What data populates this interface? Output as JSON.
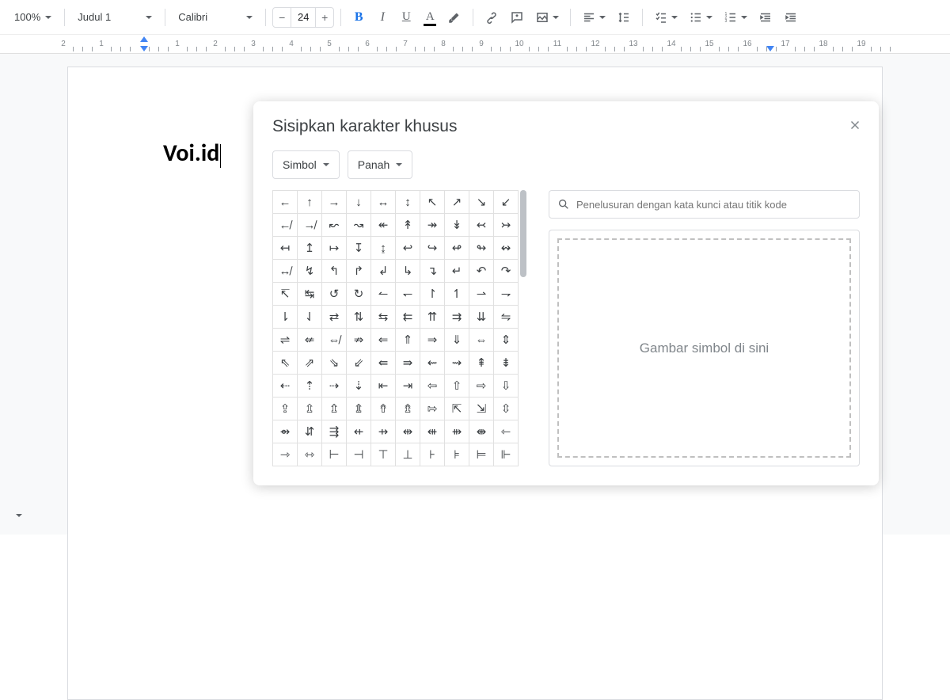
{
  "toolbar": {
    "zoom": "100%",
    "style": "Judul 1",
    "font": "Calibri",
    "fontSize": "24",
    "minusLabel": "−",
    "plusLabel": "+",
    "boldLabel": "B",
    "italicLabel": "I",
    "underlineLabel": "U"
  },
  "ruler": {
    "marks": [
      "2",
      "1",
      "",
      "1",
      "2",
      "3",
      "4",
      "5",
      "6",
      "7",
      "8",
      "9",
      "10",
      "11",
      "12",
      "13",
      "14",
      "15",
      "16",
      "17",
      "18",
      "19"
    ]
  },
  "document": {
    "text": "Voi.id"
  },
  "dialog": {
    "title": "Sisipkan karakter khusus",
    "filter1": "Simbol",
    "filter2": "Panah",
    "searchPlaceholder": "Penelusuran dengan kata kunci atau titik kode",
    "drawPlaceholder": "Gambar simbol di sini",
    "chars": [
      [
        "←",
        "↑",
        "→",
        "↓",
        "↔",
        "↕",
        "↖",
        "↗",
        "↘",
        "↙"
      ],
      [
        "↚",
        "↛",
        "↜",
        "↝",
        "↞",
        "↟",
        "↠",
        "↡",
        "↢",
        "↣"
      ],
      [
        "↤",
        "↥",
        "↦",
        "↧",
        "↨",
        "↩",
        "↪",
        "↫",
        "↬",
        "↭"
      ],
      [
        "↮",
        "↯",
        "↰",
        "↱",
        "↲",
        "↳",
        "↴",
        "↵",
        "↶",
        "↷"
      ],
      [
        "↸",
        "↹",
        "↺",
        "↻",
        "↼",
        "↽",
        "↾",
        "↿",
        "⇀",
        "⇁"
      ],
      [
        "⇂",
        "⇃",
        "⇄",
        "⇅",
        "⇆",
        "⇇",
        "⇈",
        "⇉",
        "⇊",
        "⇋"
      ],
      [
        "⇌",
        "⇍",
        "⇎",
        "⇏",
        "⇐",
        "⇑",
        "⇒",
        "⇓",
        "⇔",
        "⇕"
      ],
      [
        "⇖",
        "⇗",
        "⇘",
        "⇙",
        "⇚",
        "⇛",
        "⇜",
        "⇝",
        "⇞",
        "⇟"
      ],
      [
        "⇠",
        "⇡",
        "⇢",
        "⇣",
        "⇤",
        "⇥",
        "⇦",
        "⇧",
        "⇨",
        "⇩"
      ],
      [
        "⇪",
        "⇫",
        "⇬",
        "⇭",
        "⇮",
        "⇯",
        "⇰",
        "⇱",
        "⇲",
        "⇳"
      ],
      [
        "⇴",
        "⇵",
        "⇶",
        "⇷",
        "⇸",
        "⇹",
        "⇺",
        "⇻",
        "⇼",
        "⇽"
      ],
      [
        "⇾",
        "⇿",
        "⊢",
        "⊣",
        "⊤",
        "⊥",
        "⊦",
        "⊧",
        "⊨",
        "⊩"
      ]
    ]
  }
}
